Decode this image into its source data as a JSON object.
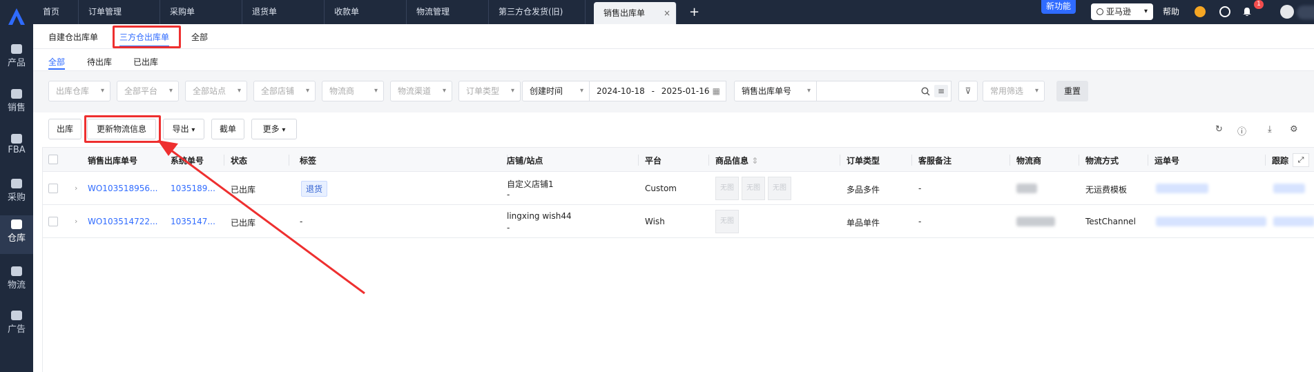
{
  "left_nav": [
    {
      "label": "产品",
      "icon": "product-icon"
    },
    {
      "label": "销售",
      "icon": "sales-icon"
    },
    {
      "label": "FBA",
      "icon": "fba-icon"
    },
    {
      "label": "采购",
      "icon": "cart-icon"
    },
    {
      "label": "仓库",
      "icon": "warehouse-icon",
      "active": true
    },
    {
      "label": "物流",
      "icon": "truck-icon"
    },
    {
      "label": "广告",
      "icon": "ad-icon"
    }
  ],
  "tabs": [
    {
      "label": "首页"
    },
    {
      "label": "订单管理"
    },
    {
      "label": "采购单"
    },
    {
      "label": "退货单"
    },
    {
      "label": "收款单"
    },
    {
      "label": "物流管理"
    },
    {
      "label": "第三方仓发货(旧)"
    },
    {
      "label": "销售出库单",
      "active": true,
      "close": "×"
    }
  ],
  "tab_add": "+",
  "header": {
    "new_feature": "新功能",
    "platform_select": "亚马逊",
    "help": "帮助",
    "notification_count": "1"
  },
  "subtabs": [
    {
      "label": "自建仓出库单"
    },
    {
      "label": "三方仓出库单",
      "active": true
    },
    {
      "label": "全部"
    }
  ],
  "status_tabs": [
    {
      "label": "全部",
      "active": true
    },
    {
      "label": "待出库"
    },
    {
      "label": "已出库"
    }
  ],
  "filters": {
    "selects": [
      "出库仓库",
      "全部平台",
      "全部站点",
      "全部店铺",
      "物流商",
      "物流渠道",
      "订单类型"
    ],
    "date_type": "创建时间",
    "date_start": "2024-10-18",
    "date_sep": "-",
    "date_end": "2025-01-16",
    "search_type": "销售出库单号",
    "search_value": "",
    "common_filter": "常用筛选",
    "reset": "重置"
  },
  "toolbar": {
    "outbound": "出库",
    "update_logistics": "更新物流信息",
    "export": "导出",
    "cut_order": "截单",
    "more": "更多"
  },
  "table": {
    "columns": [
      "销售出库单号",
      "系统单号",
      "状态",
      "标签",
      "店铺/站点",
      "平台",
      "商品信息",
      "订单类型",
      "客服备注",
      "物流商",
      "物流方式",
      "运单号",
      "跟踪"
    ],
    "rows": [
      {
        "order_no": "WO103518956...",
        "sys_no": "1035189...",
        "status": "已出库",
        "tag": "退货",
        "store": "自定义店铺1",
        "site": "-",
        "platform": "Custom",
        "no_image": "无图",
        "order_type": "多品多件",
        "remark": "-",
        "ship_method": "无运费模板"
      },
      {
        "order_no": "WO103514722...",
        "sys_no": "1035147...",
        "status": "已出库",
        "tag": "-",
        "store": "lingxing wish44",
        "site": "-",
        "platform": "Wish",
        "no_image": "无图",
        "order_type": "单品单件",
        "remark": "-",
        "ship_method": "TestChannel"
      }
    ]
  },
  "colors": {
    "nav_bg": "#1f2a3d",
    "accent": "#2f6bff",
    "highlight_red": "#ee2f2f"
  }
}
